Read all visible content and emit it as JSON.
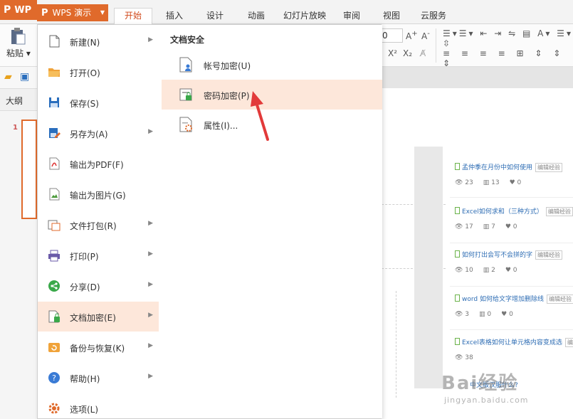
{
  "app": {
    "logo_text": "WP",
    "menu_button": "WPS 演示"
  },
  "tabs": [
    "开始",
    "插入",
    "设计",
    "动画",
    "幻灯片放映",
    "审阅",
    "视图",
    "云服务"
  ],
  "ribbon": {
    "paste_label": "粘贴",
    "font_size_value": "0"
  },
  "side_panel": {
    "outline_label": "大纲",
    "slide_number": "1"
  },
  "file_menu": {
    "items": [
      {
        "label": "新建(N)",
        "icon": "new-file-icon",
        "has_submenu": true
      },
      {
        "label": "打开(O)",
        "icon": "open-folder-icon",
        "has_submenu": false
      },
      {
        "label": "保存(S)",
        "icon": "save-icon",
        "has_submenu": false
      },
      {
        "label": "另存为(A)",
        "icon": "save-as-icon",
        "has_submenu": true
      },
      {
        "label": "输出为PDF(F)",
        "icon": "pdf-export-icon",
        "has_submenu": false
      },
      {
        "label": "输出为图片(G)",
        "icon": "image-export-icon",
        "has_submenu": false
      },
      {
        "label": "文件打包(R)",
        "icon": "package-icon",
        "has_submenu": true
      },
      {
        "label": "打印(P)",
        "icon": "print-icon",
        "has_submenu": true
      },
      {
        "label": "分享(D)",
        "icon": "share-icon",
        "has_submenu": true
      },
      {
        "label": "文档加密(E)",
        "icon": "encrypt-document-icon",
        "has_submenu": true
      },
      {
        "label": "备份与恢复(K)",
        "icon": "backup-icon",
        "has_submenu": true
      },
      {
        "label": "帮助(H)",
        "icon": "help-icon",
        "has_submenu": true
      },
      {
        "label": "选项(L)",
        "icon": "options-gear-icon",
        "has_submenu": false
      }
    ],
    "highlighted_index": 9
  },
  "submenu": {
    "header": "文档安全",
    "items": [
      {
        "label": "帐号加密(U)",
        "icon": "account-encrypt-icon"
      },
      {
        "label": "密码加密(P)",
        "icon": "password-encrypt-icon"
      },
      {
        "label": "属性(I)...",
        "icon": "properties-icon"
      }
    ],
    "highlighted_index": 1
  },
  "slide_content": {
    "articles": [
      {
        "title": "孟仲季在月份中如何使用",
        "tag": "编辑经验",
        "views": "23",
        "votes": "13",
        "likes": "0"
      },
      {
        "title": "Excel如何求和（三种方式）",
        "tag": "编辑经验",
        "views": "17",
        "votes": "7",
        "likes": "0"
      },
      {
        "title": "如何打出会写不会拼的字",
        "tag": "编辑经验",
        "views": "10",
        "votes": "2",
        "likes": "0"
      },
      {
        "title": "word 如何给文字增加删除线",
        "tag": "编辑经验",
        "views": "3",
        "votes": "0",
        "likes": "0"
      },
      {
        "title": "Excel表格如何让单元格内容变成选",
        "tag": "编辑经验",
        "views": "38",
        "votes": "",
        "likes": ""
      }
    ],
    "partial_question": "中文版汉服什么?"
  },
  "watermark": {
    "text": "Bai经验",
    "url": "jingyan.baidu.com"
  },
  "colors": {
    "accent": "#e06a2b",
    "highlight": "#fde7da",
    "arrow": "#e23a3a",
    "link": "#2e6db4"
  }
}
